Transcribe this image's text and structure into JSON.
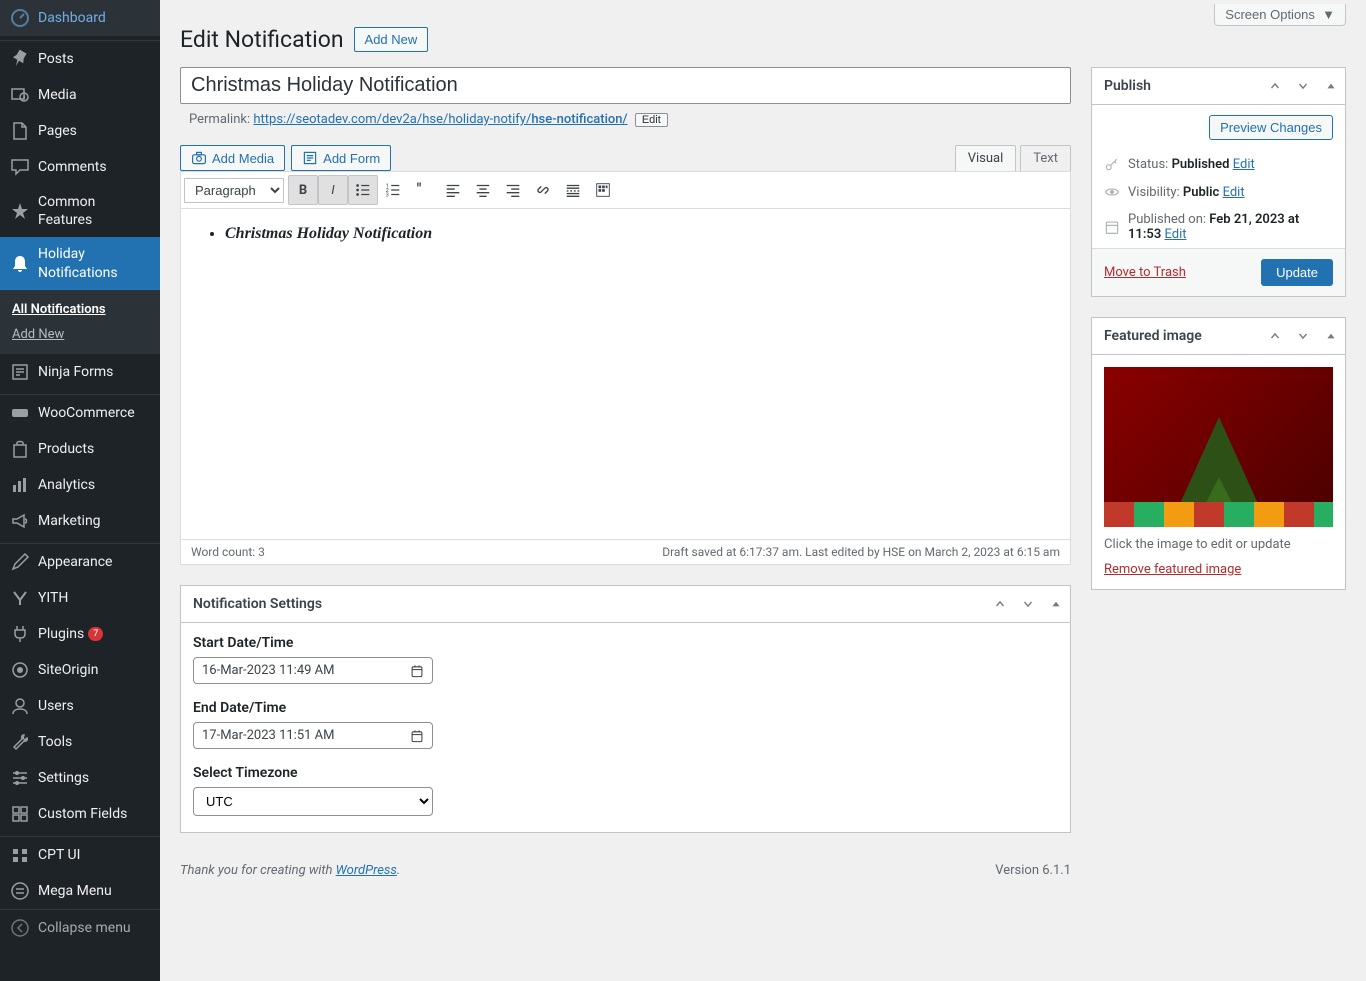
{
  "topbar": {
    "screen_options": "Screen Options"
  },
  "sidebar": {
    "items": [
      {
        "label": "Dashboard"
      },
      {
        "label": "Posts"
      },
      {
        "label": "Media"
      },
      {
        "label": "Pages"
      },
      {
        "label": "Comments"
      },
      {
        "label": "Common Features"
      },
      {
        "label": "Holiday Notifications"
      },
      {
        "label": "Ninja Forms"
      },
      {
        "label": "WooCommerce"
      },
      {
        "label": "Products"
      },
      {
        "label": "Analytics"
      },
      {
        "label": "Marketing"
      },
      {
        "label": "Appearance"
      },
      {
        "label": "YITH"
      },
      {
        "label": "Plugins",
        "badge": "7"
      },
      {
        "label": "SiteOrigin"
      },
      {
        "label": "Users"
      },
      {
        "label": "Tools"
      },
      {
        "label": "Settings"
      },
      {
        "label": "Custom Fields"
      },
      {
        "label": "CPT UI"
      },
      {
        "label": "Mega Menu"
      }
    ],
    "submenu": [
      {
        "label": "All Notifications"
      },
      {
        "label": "Add New"
      }
    ],
    "collapse": "Collapse menu"
  },
  "header": {
    "page_title": "Edit Notification",
    "add_new": "Add New"
  },
  "post": {
    "title_value": "Christmas Holiday Notification",
    "permalink_label": "Permalink:",
    "permalink_base": "https://seotadev.com/dev2a/hse/holiday-notify/",
    "permalink_slug": "hse-notification/",
    "permalink_edit": "Edit"
  },
  "editor": {
    "add_media": "Add Media",
    "add_form": "Add Form",
    "tab_visual": "Visual",
    "tab_text": "Text",
    "format_select": "Paragraph",
    "content_item": "Christmas Holiday Notification",
    "word_count_label": "Word count: 3",
    "status_right": "Draft saved at 6:17:37 am. Last edited by HSE on March 2, 2023 at 6:15 am"
  },
  "notif_settings": {
    "box_title": "Notification Settings",
    "start_label": "Start Date/Time",
    "start_value": "16-Mar-2023 11:49 AM",
    "end_label": "End Date/Time",
    "end_value": "17-Mar-2023 11:51 AM",
    "tz_label": "Select Timezone",
    "tz_value": "UTC"
  },
  "publish": {
    "box_title": "Publish",
    "preview_btn": "Preview Changes",
    "status_label": "Status:",
    "status_value": "Published",
    "visibility_label": "Visibility:",
    "visibility_value": "Public",
    "published_label": "Published on:",
    "published_value": "Feb 21, 2023 at 11:53",
    "edit": "Edit",
    "trash": "Move to Trash",
    "update": "Update"
  },
  "featured": {
    "box_title": "Featured image",
    "hint": "Click the image to edit or update",
    "remove": "Remove featured image"
  },
  "footer": {
    "thanks_pre": "Thank you for creating with ",
    "wp": "WordPress",
    "version": "Version 6.1.1"
  }
}
